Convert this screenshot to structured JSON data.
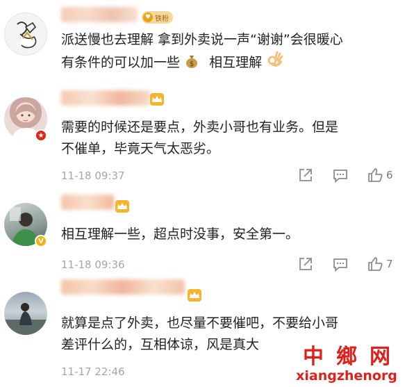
{
  "comments": [
    {
      "text_lines": [
        "派送慢也去理解 拿到外卖说一声“谢谢”会很暖心",
        "有条件的可以加一些"
      ],
      "text_line2_suffix": "相互理解",
      "fan_badge": "铁粉",
      "has_meta": false
    },
    {
      "text_lines": [
        "需要的时候还是要点，外卖小哥也有业务。但是",
        "不催单，毕竟天气太恶劣。"
      ],
      "timestamp": "11-18 09:37",
      "likes": "6"
    },
    {
      "text_lines": [
        "相互理解一些，超点时没事，安全第一。"
      ],
      "timestamp": "11-18 09:36",
      "likes": "7"
    },
    {
      "text_lines": [
        "就算是点了外卖，也尽量不要催吧，不要给小哥",
        "差评什么的，互相体谅，风是真大"
      ],
      "timestamp": "11-17 22:46"
    }
  ],
  "icons": {
    "share": "share-icon",
    "reply": "comment-icon",
    "like": "thumbs-up-icon",
    "money_bag": "money-bag-emoji",
    "ok_hand": "ok-hand-emoji"
  },
  "watermark": {
    "cn": "中鄉网",
    "en": "xiangzhenorg"
  },
  "colors": {
    "text": "#222222",
    "meta": "#a6a6a6",
    "watermark": "#e0201a",
    "badge": "#f3b430"
  }
}
